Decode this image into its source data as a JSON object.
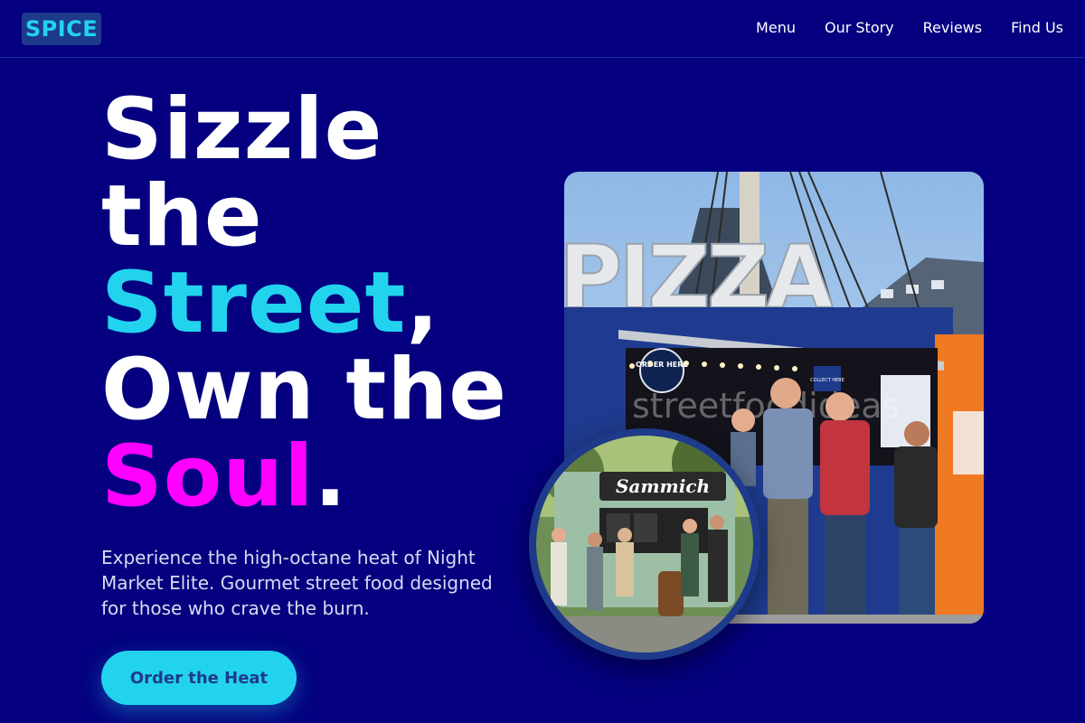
{
  "brand": {
    "logo_text": "SPICE"
  },
  "nav": {
    "links": [
      {
        "label": "Menu"
      },
      {
        "label": "Our Story"
      },
      {
        "label": "Reviews"
      },
      {
        "label": "Find Us"
      }
    ]
  },
  "hero": {
    "headline": {
      "line1": "Sizzle",
      "line2": "the",
      "line3_highlight": "Street",
      "line3_rest": ",",
      "line4": "Own the",
      "line5_highlight": "Soul",
      "line5_rest": "."
    },
    "subtitle": "Experience the high-octane heat of Night Market Elite. Gourmet street food designed for those who crave the burn.",
    "cta_label": "Order the Heat"
  },
  "photos": {
    "main": {
      "sign_text": "PIZZA",
      "order_sign": "ORDER HERE",
      "collect_sign": "COLLECT HERE",
      "watermark": "streetfoodideas"
    },
    "inset": {
      "sign_text": "Sammich"
    }
  },
  "colors": {
    "background": "#04007f",
    "accent_cyan": "#22d3ee",
    "accent_magenta": "#ff00ff",
    "logo_bg": "#1e3a8a",
    "cta_text": "#1e3a8a"
  },
  "icons": {
    "main_photo": "food-truck-photo",
    "inset_photo": "food-truck-crowd-photo"
  }
}
